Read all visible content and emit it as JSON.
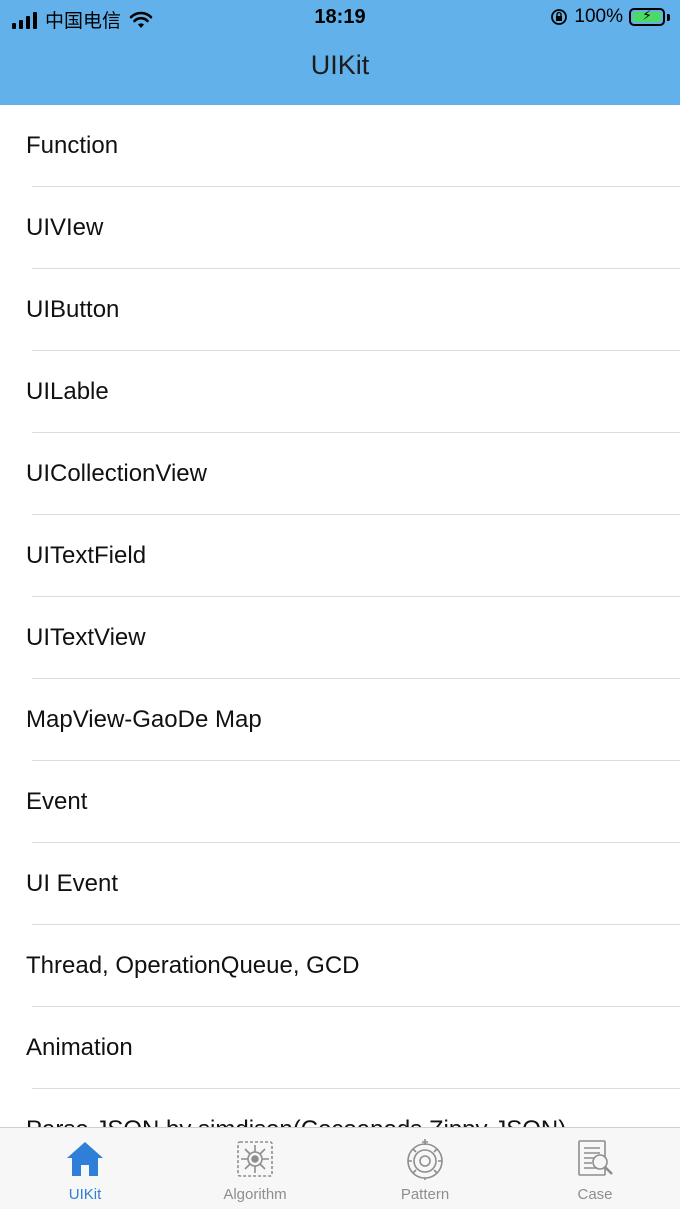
{
  "status_bar": {
    "carrier": "中国电信",
    "time": "18:19",
    "battery": "100%",
    "icons": [
      "signal-icon",
      "wifi-icon",
      "rotation-lock-icon",
      "battery-icon"
    ]
  },
  "nav": {
    "title": "UIKit"
  },
  "list": {
    "items": [
      "Function",
      "UIVIew",
      "UIButton",
      "UILable",
      "UICollectionView",
      "UITextField",
      "UITextView",
      "MapView-GaoDe Map",
      "Event",
      "UI Event",
      "Thread, OperationQueue, GCD",
      "Animation",
      "Parse JSON by simdjson(Cocoapods Zippy JSON)"
    ]
  },
  "tabbar": {
    "tabs": [
      {
        "label": "UIKit",
        "icon": "home-icon",
        "active": true
      },
      {
        "label": "Algorithm",
        "icon": "algorithm-icon",
        "active": false
      },
      {
        "label": "Pattern",
        "icon": "pattern-icon",
        "active": false
      },
      {
        "label": "Case",
        "icon": "case-icon",
        "active": false
      }
    ]
  },
  "colors": {
    "nav_background": "#62b1ea",
    "tab_active": "#2f7fd8",
    "tab_inactive": "#8e8e8e"
  }
}
